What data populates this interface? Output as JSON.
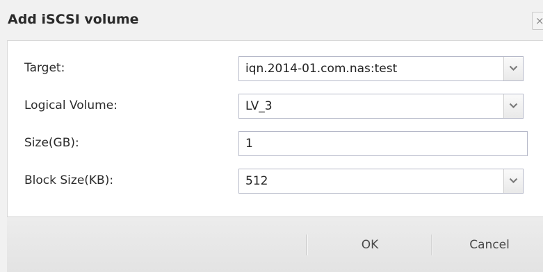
{
  "dialog": {
    "title": "Add iSCSI volume",
    "close_glyph": "×"
  },
  "form": {
    "fields": [
      {
        "label": "Target:",
        "value": "iqn.2014-01.com.nas:test",
        "kind": "combo"
      },
      {
        "label": "Logical Volume:",
        "value": "LV_3",
        "kind": "combo"
      },
      {
        "label": "Size(GB):",
        "value": "1",
        "kind": "text"
      },
      {
        "label": "Block Size(KB):",
        "value": "512",
        "kind": "combo"
      }
    ]
  },
  "footer": {
    "ok_label": "OK",
    "cancel_label": "Cancel"
  },
  "icons": {
    "dropdown": "chevron-down-icon",
    "close": "close-icon"
  },
  "colors": {
    "panel_bg": "#ffffff",
    "chrome_bg": "#f1f1f1",
    "field_border": "#b5b8c8"
  }
}
